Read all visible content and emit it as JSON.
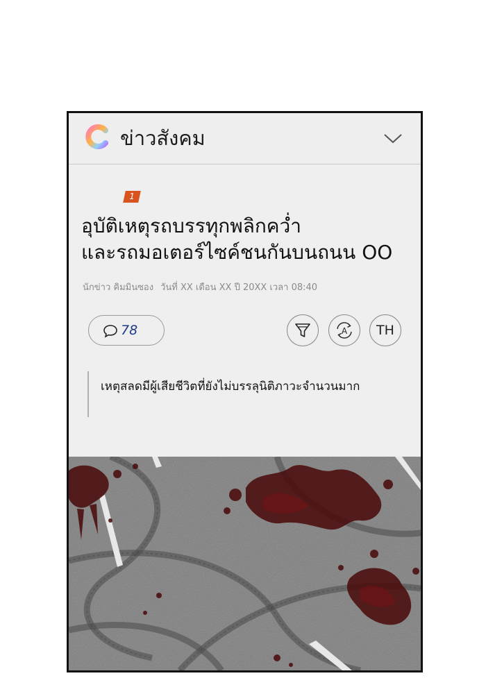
{
  "header": {
    "logo_icon": "c-logo-icon",
    "section_title": "ข่าวสังคม",
    "dropdown_icon": "chevron-down-icon"
  },
  "article": {
    "rank": "1",
    "rank_color": "#d9531e",
    "headline_line1": "อุบัติเหตุรถบรรทุกพลิกคว่ำ",
    "headline_line2": "และรถมอเตอร์ไซค์ชนกันบนถนน OO",
    "byline_reporter": "นักข่าว คิมมินซอง",
    "byline_date": "วันที่ XX เดือน XX ปี 20XX เวลา 08:40"
  },
  "toolbar": {
    "comment_icon": "speech-bubble-icon",
    "comment_count": "78",
    "filter_icon": "filter-icon",
    "font_icon": "font-refresh-icon",
    "language_label": "TH"
  },
  "summary": {
    "quote": "เหตุสลดมีผู้เสียชีวิตที่ยังไม่บรรลุนิติภาวะจำนวนมาก"
  },
  "scene": {
    "illustration": "bloody-road-with-skid-marks"
  }
}
